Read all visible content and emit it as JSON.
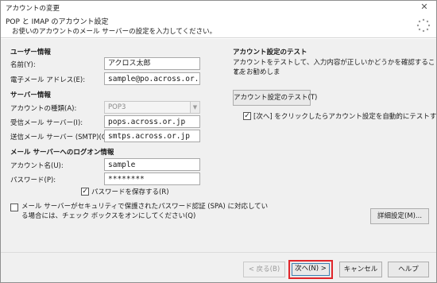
{
  "window": {
    "title": "アカウントの変更"
  },
  "header": {
    "title": "POP と IMAP のアカウント設定",
    "subtitle": "お使いのアカウントのメール サーバーの設定を入力してください。"
  },
  "user_info": {
    "heading": "ユーザー情報",
    "name_label": "名前(Y):",
    "name_value": "アクロス太郎",
    "email_label": "電子メール アドレス(E):",
    "email_value": "sample@po.across.or.jp"
  },
  "server_info": {
    "heading": "サーバー情報",
    "account_type_label": "アカウントの種類(A):",
    "account_type_value": "POP3",
    "incoming_label": "受信メール サーバー(I):",
    "incoming_value": "pops.across.or.jp",
    "outgoing_label": "送信メール サーバー (SMTP)(O):",
    "outgoing_value": "smtps.across.or.jp"
  },
  "logon_info": {
    "heading": "メール サーバーへのログオン情報",
    "account_name_label": "アカウント名(U):",
    "account_name_value": "sample",
    "password_label": "パスワード(P):",
    "password_value": "********",
    "remember_password_label": "パスワードを保存する(R)",
    "remember_password_checked": true
  },
  "spa": {
    "label_line1": "メール サーバーがセキュリティで保護されたパスワード認証 (SPA) に対応してい",
    "label_line2": "る場合には、チェック ボックスをオンにしてください(Q)",
    "checked": false
  },
  "test": {
    "heading": "アカウント設定のテスト",
    "desc_line1": "アカウントをテストして、入力内容が正しいかどうかを確認することをお勧めしま",
    "desc_line2": "す。",
    "button_label": "アカウント設定のテスト(T)",
    "auto_test_label": "[次へ] をクリックしたらアカウント設定を自動的にテストする(S)",
    "auto_test_checked": true
  },
  "more_settings_label": "詳細設定(M)...",
  "footer": {
    "back_label": "< 戻る(B)",
    "next_label": "次へ(N) >",
    "cancel_label": "キャンセル",
    "help_label": "ヘルプ"
  },
  "colors": {
    "highlight": "#e0262b",
    "dialog_bg": "#f0f0f0",
    "focus_border": "#3c7fb1"
  }
}
